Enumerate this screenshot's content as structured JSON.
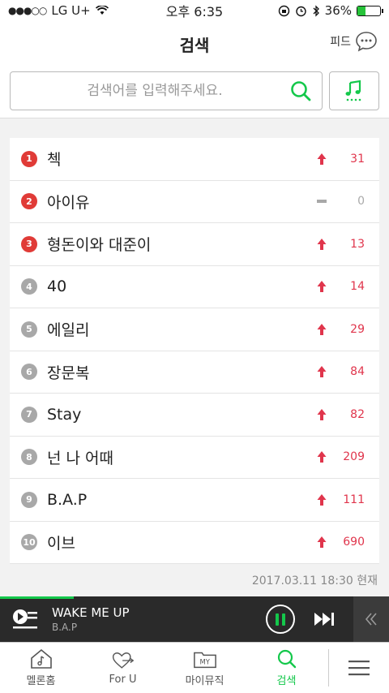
{
  "status": {
    "carrier": "LG U+",
    "time": "오후 6:35",
    "battery": "36%",
    "battery_level": 0.36
  },
  "header": {
    "title": "검색",
    "feed_label": "피드"
  },
  "search": {
    "placeholder": "검색어를 입력해주세요.",
    "icon": "search-icon",
    "music_icon": "music-recognition-icon"
  },
  "chart": {
    "items": [
      {
        "rank": "1",
        "keyword": "첵",
        "trend": "up",
        "delta": "31"
      },
      {
        "rank": "2",
        "keyword": "아이유",
        "trend": "same",
        "delta": "0"
      },
      {
        "rank": "3",
        "keyword": "형돈이와 대준이",
        "trend": "up",
        "delta": "13"
      },
      {
        "rank": "4",
        "keyword": "40",
        "trend": "up",
        "delta": "14"
      },
      {
        "rank": "5",
        "keyword": "에일리",
        "trend": "up",
        "delta": "29"
      },
      {
        "rank": "6",
        "keyword": "장문복",
        "trend": "up",
        "delta": "84"
      },
      {
        "rank": "7",
        "keyword": "Stay",
        "trend": "up",
        "delta": "82"
      },
      {
        "rank": "8",
        "keyword": "넌 나 어때",
        "trend": "up",
        "delta": "209"
      },
      {
        "rank": "9",
        "keyword": "B.A.P",
        "trend": "up",
        "delta": "111"
      },
      {
        "rank": "10",
        "keyword": "이브",
        "trend": "up",
        "delta": "690"
      }
    ],
    "timestamp": "2017.03.11 18:30 현재"
  },
  "player": {
    "title": "WAKE ME UP",
    "artist": "B.A.P",
    "progress": 0.19
  },
  "tabs": [
    {
      "label": "멜론홈",
      "icon": "melon-home-icon",
      "active": false
    },
    {
      "label": "For U",
      "icon": "for-u-heart-icon",
      "active": false
    },
    {
      "label": "마이뮤직",
      "icon": "my-music-icon",
      "active": false
    },
    {
      "label": "검색",
      "icon": "search-icon",
      "active": true
    }
  ],
  "colors": {
    "accent": "#14c84b",
    "rank_top": "#e03b37",
    "rank_low": "#a8a8a8",
    "up": "#e0354c"
  }
}
